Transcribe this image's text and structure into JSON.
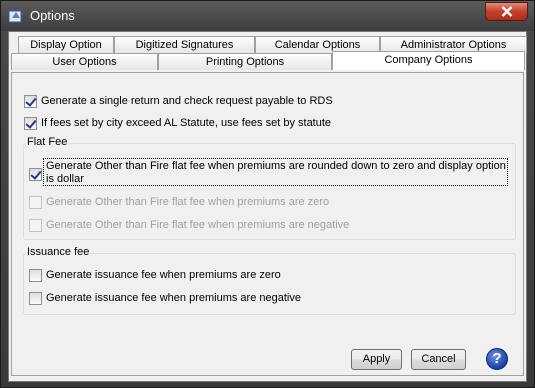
{
  "window": {
    "title": "Options",
    "icon": "app-icon",
    "close_icon": "close-icon"
  },
  "tabs": {
    "row_top": [
      {
        "label": "Display Option"
      },
      {
        "label": "Digitized Signatures"
      },
      {
        "label": "Calendar Options"
      },
      {
        "label": "Administrator Options"
      }
    ],
    "row_bottom": [
      {
        "label": "User Options"
      },
      {
        "label": "Printing Options"
      },
      {
        "label": "Company Options",
        "active": true
      }
    ]
  },
  "options": {
    "single_return": {
      "label": "Generate a single return and check request payable to RDS",
      "checked": true
    },
    "city_fees": {
      "label": "If fees set by city exceed AL Statute, use fees set by statute",
      "checked": true
    }
  },
  "flat_fee": {
    "title": "Flat Fee",
    "items": [
      {
        "label_line1": "Generate Other than Fire flat fee when premiums are rounded down to zero and display option",
        "label_line2": "is dollar",
        "checked": true,
        "enabled": true
      },
      {
        "label": "Generate Other than Fire flat fee when premiums are zero",
        "checked": false,
        "enabled": false
      },
      {
        "label": "Generate Other than Fire flat fee when premiums are negative",
        "checked": false,
        "enabled": false
      }
    ]
  },
  "issuance_fee": {
    "title": "Issuance fee",
    "items": [
      {
        "label": "Generate issuance fee when premiums are zero",
        "checked": false
      },
      {
        "label": "Generate issuance fee when premiums are negative",
        "checked": false
      }
    ]
  },
  "buttons": {
    "apply": "Apply",
    "cancel": "Cancel",
    "help": "?"
  }
}
